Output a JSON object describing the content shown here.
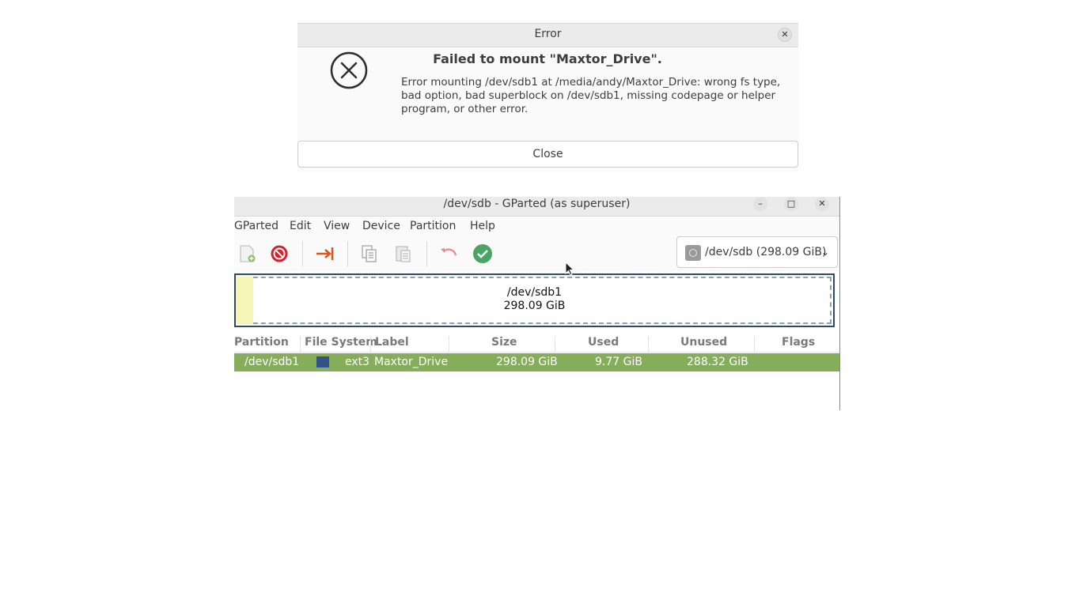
{
  "dialog": {
    "title": "Error",
    "heading": "Failed to mount \"Maxtor_Drive\".",
    "message_lines": [
      "Error mounting /dev/sdb1 at /media/andy/Maxtor_Drive: wrong fs type,",
      "bad option, bad superblock on /dev/sdb1, missing codepage or helper",
      "program, or other error."
    ],
    "close_button": "Close",
    "close_x": "✕"
  },
  "gparted": {
    "title": "/dev/sdb - GParted (as superuser)",
    "window_controls": {
      "minimize": "–",
      "maximize": "□",
      "close": "✕"
    },
    "menu": [
      "GParted",
      "Edit",
      "View",
      "Device",
      "Partition",
      "Help"
    ],
    "toolbar_icons": [
      "new-icon",
      "delete-icon",
      "resize-move-icon",
      "copy-icon",
      "paste-icon",
      "undo-icon",
      "apply-icon"
    ],
    "device_selector": "/dev/sdb (298.09 GiB)",
    "graphic": {
      "name": "/dev/sdb1",
      "size": "298.09 GiB",
      "used_fraction": 0.0328
    },
    "columns": [
      "Partition",
      "File System",
      "Label",
      "Size",
      "Used",
      "Unused",
      "Flags"
    ],
    "rows": [
      {
        "partition": "/dev/sdb1",
        "filesystem": "ext3",
        "filesystem_color": "#35538a",
        "label": "Maxtor_Drive",
        "size": "298.09 GiB",
        "used": "9.77 GiB",
        "unused": "288.32 GiB",
        "flags": ""
      }
    ]
  },
  "colors": {
    "selected_row": "#86ad5a",
    "used_space": "#f7f6b9",
    "delete_red": "#d9202a",
    "apply_green": "#4aa564",
    "resize_orange": "#e0541d"
  }
}
